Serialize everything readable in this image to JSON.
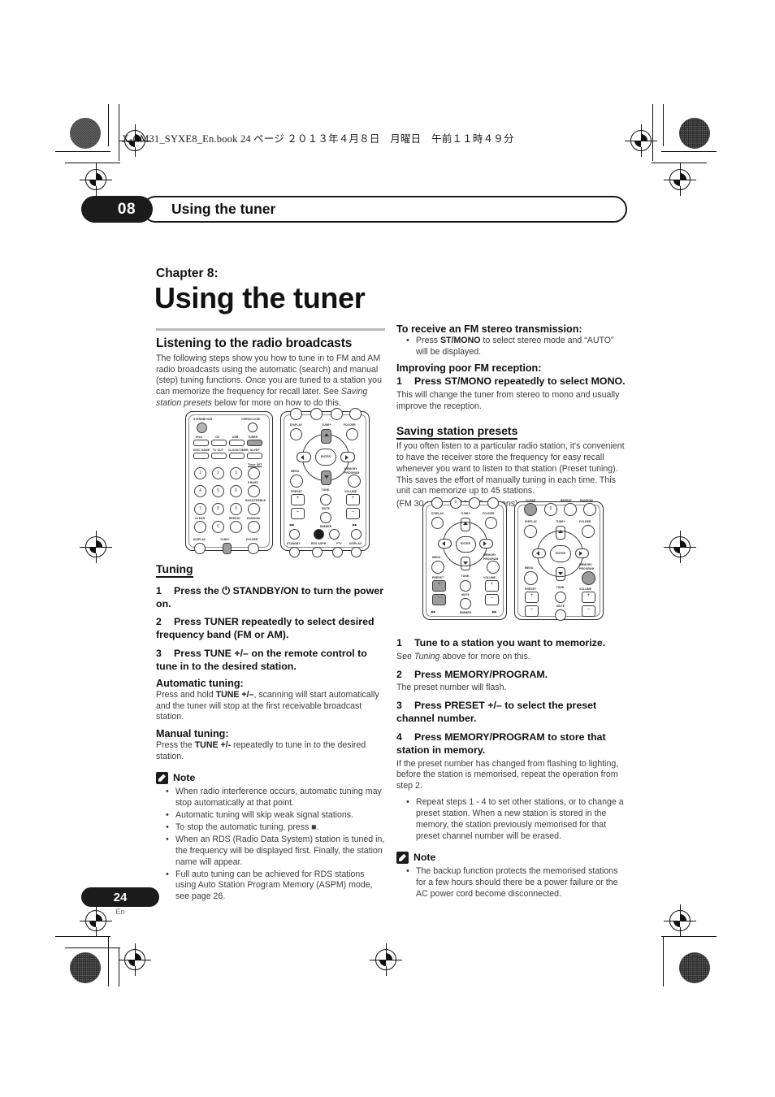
{
  "page": {
    "book_header": "X-CM31_SYXE8_En.book   24 ページ   ２０１３年４月８日　月曜日　午前１１時４９分",
    "page_number": "24",
    "language_code": "En"
  },
  "running_head": {
    "chapter_number": "08",
    "title": "Using the tuner"
  },
  "chapter": {
    "label": "Chapter 8:",
    "title": "Using the tuner"
  },
  "left_column": {
    "listening": {
      "heading": "Listening to the radio broadcasts",
      "body": "The following steps show you how to tune in to FM and AM radio broadcasts using the automatic (search) and manual (step) tuning functions. Once you are tuned to a station you can memorize the frequency for recall later. See ",
      "body_italic": "Saving station presets",
      "body_end": " below for more on how to do this."
    },
    "tuning": {
      "heading": "Tuning",
      "step1": "Press the ⏻ STANDBY/ON to turn the power on.",
      "step1_num": "1",
      "step2": "Press TUNER repeatedly to select desired frequency band (FM or AM).",
      "step2_num": "2",
      "step3": "Press TUNE +/– on the remote control to tune in to the desired station.",
      "step3_num": "3",
      "automatic_heading": "Automatic tuning:",
      "automatic_body_a": "Press and hold ",
      "automatic_body_b": "TUNE +/–",
      "automatic_body_c": ", scanning will start automatically and the tuner will stop at the first receivable broadcast station.",
      "manual_heading": "Manual tuning:",
      "manual_body_a": "Press the ",
      "manual_body_b": "TUNE +/-",
      "manual_body_c": " repeatedly to tune in to the desired station."
    },
    "note": {
      "title": "Note",
      "items": [
        "When radio interference occurs, automatic tuning may stop automatically at that point.",
        "Automatic tuning will skip weak signal stations.",
        "To stop the automatic tuning, press ■.",
        "When an RDS (Radio Data System) station is tuned in, the frequency will be displayed first. Finally, the station name will appear.",
        "Full auto tuning can be achieved for RDS stations using Auto Station Program Memory (ASPM) mode, see page 26."
      ]
    }
  },
  "right_column": {
    "fm_stereo": {
      "heading": "To receive an FM stereo transmission:",
      "bullet_a": "Press ",
      "bullet_b": "ST/MONO",
      "bullet_c": " to select stereo mode and “AUTO” will be displayed."
    },
    "improving": {
      "heading": "Improving poor FM reception:",
      "step1_num": "1",
      "step1": "Press ST/MONO repeatedly to select MONO.",
      "body": "This will change the tuner from stereo to mono and usually improve the reception."
    },
    "saving": {
      "heading": "Saving station presets",
      "body": "If you often listen to a particular radio station, it's convenient to have the receiver store the frequency for easy recall whenever you want to listen to that station (Preset tuning). This saves the effort of manually tuning in each time. This unit can memorize up to 45 stations.",
      "subnote": "(FM 30 stations/AM 15 stations)",
      "step1_num": "1",
      "step1": "Tune to a station you want to memorize.",
      "step1_body_a": "See ",
      "step1_body_i": "Tuning",
      "step1_body_b": " above for more on this.",
      "step2_num": "2",
      "step2": "Press MEMORY/PROGRAM.",
      "step2_body": "The preset number will flash.",
      "step3_num": "3",
      "step3": "Press PRESET +/– to select the preset channel number.",
      "step4_num": "4",
      "step4": "Press MEMORY/PROGRAM to store that station in memory.",
      "step4_body": "If the preset number has changed from flashing to lighting, before the station is memorised, repeat the operation from step 2.",
      "bullet": "Repeat steps 1 - 4 to set other stations, or to change a preset station. When a new station is stored in the memory, the station previously memorised for that preset channel number will be erased."
    },
    "note": {
      "title": "Note",
      "items": [
        "The backup function protects the memorised stations for a few hours should there be a power failure or the AC power cord become disconnected."
      ]
    }
  },
  "figure_1": {
    "caption_hidden": "remote control illustration showing TUNER and TUNE +/- keys highlighted",
    "left_panel_labels": [
      "STANDBY/ON",
      "OPEN/CLOSE",
      "iPod",
      "CD",
      "USB",
      "TUNER",
      "DISC NAME",
      "TV OUT",
      "CLOCK/TIMER",
      "SLEEP",
      "Timer SET",
      "P.BASS",
      "BASS/TREBLE",
      "CLEAR",
      "REPEAT",
      "RANDOM",
      "DISPLAY",
      "TUNE+",
      "FOLDER"
    ],
    "right_panel_labels": [
      "DISPLAY",
      "TUNE+",
      "FOLDER",
      "ENTER",
      "MENU",
      "MEMORY/PROGRAM",
      "PRESET",
      "TUNE-",
      "VOLUME",
      "MUTE",
      "DIMMER",
      "STANDBY",
      "RDS ASPM",
      "PTY",
      "DISPLAY"
    ],
    "numeric_keys": [
      "1",
      "2",
      "3",
      "4",
      "5",
      "6",
      "7",
      "8",
      "9",
      "0"
    ],
    "highlighted": [
      "TUNER",
      "TUNE+",
      "TUNE-"
    ]
  },
  "figure_2": {
    "caption_hidden": "remote control illustration showing PRESET and MEMORY/PROGRAM keys highlighted",
    "left_panel_labels": [
      "0",
      "DISPLAY",
      "TUNE+",
      "FOLDER",
      "ENTER",
      "MENU",
      "MEMORY/PROGRAM",
      "PRESET",
      "TUNE-",
      "VOLUME",
      "MUTE",
      "DIMMER"
    ],
    "right_panel_labels": [
      "CLEAR",
      "REPEAT",
      "RANDOM",
      "0",
      "DISPLAY",
      "TUNE+",
      "FOLDER",
      "ENTER",
      "MENU",
      "MEMORY/PROGRAM",
      "PRESET",
      "TUNE-",
      "VOLUME",
      "MUTE"
    ],
    "highlighted": [
      "PRESET",
      "CLEAR",
      "MEMORY/PROGRAM"
    ]
  },
  "colors": {
    "ink": "#1b1b1b",
    "body_text": "#3b3b3b",
    "rule": "#b9b9bd",
    "highlight_key": "#9d9d9d"
  }
}
